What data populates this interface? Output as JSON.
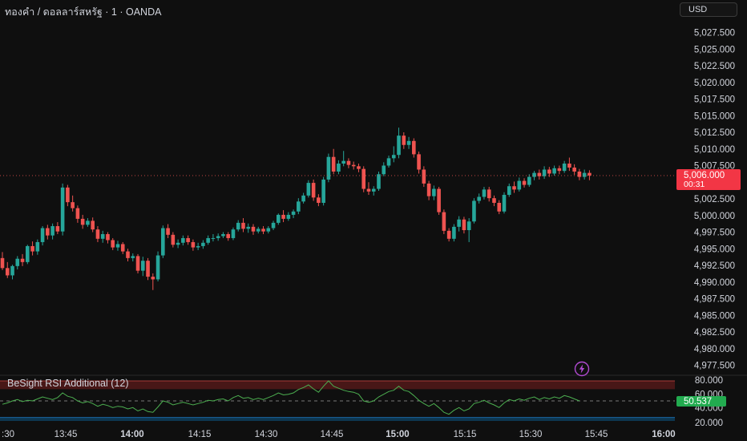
{
  "header": {
    "symbol_title": "ทองคำ / ดอลลาร์สหรัฐ · 1 · OANDA",
    "currency_button": "USD"
  },
  "price_badge": {
    "price": "5,006.000",
    "countdown": "00:31"
  },
  "indicator": {
    "name": "BeSight RSI Additional (12)",
    "current_value": "50.537",
    "axis_ticks": [
      "80.000",
      "60.000",
      "40.000",
      "20.000"
    ]
  },
  "colors": {
    "up": "#26a69a",
    "down": "#ef5350",
    "rsi_line": "#4caf50",
    "overbought_band": "#5c1b1b",
    "oversold_band": "#0d3d5c",
    "badge": "#f23645",
    "rsi_badge": "#22ab4f"
  },
  "icons": {
    "alert": "lightning-icon"
  },
  "chart_data": {
    "type": "candlestick",
    "y_axis_ticks": [
      "5,027.500",
      "5,025.000",
      "5,022.500",
      "5,020.000",
      "5,017.500",
      "5,015.000",
      "5,012.500",
      "5,010.000",
      "5,007.500",
      "5,005.000",
      "5,002.500",
      "5,000.000",
      "4,997.500",
      "4,995.000",
      "4,992.500",
      "4,990.000",
      "4,987.500",
      "4,985.000",
      "4,982.500",
      "4,980.000",
      "4,977.500"
    ],
    "x_axis_ticks": [
      {
        "label": ":30",
        "bold": false
      },
      {
        "label": "13:45",
        "bold": false
      },
      {
        "label": "14:00",
        "bold": true
      },
      {
        "label": "14:15",
        "bold": false
      },
      {
        "label": "14:30",
        "bold": false
      },
      {
        "label": "14:45",
        "bold": false
      },
      {
        "label": "15:00",
        "bold": true
      },
      {
        "label": "15:15",
        "bold": false
      },
      {
        "label": "15:30",
        "bold": false
      },
      {
        "label": "15:45",
        "bold": false
      },
      {
        "label": "16:00",
        "bold": true
      }
    ],
    "ylim": [
      4976,
      5031
    ],
    "last_price": 5006.0,
    "candles": [
      [
        4993.6,
        4994.5,
        4991.8,
        4992.1
      ],
      [
        4992.1,
        4993.0,
        4990.6,
        4991.0
      ],
      [
        4991.0,
        4992.6,
        4990.4,
        4992.4
      ],
      [
        4992.4,
        4993.9,
        4991.9,
        4993.5
      ],
      [
        4993.5,
        4994.2,
        4992.4,
        4993.0
      ],
      [
        4993.0,
        4995.6,
        4992.7,
        4995.4
      ],
      [
        4995.4,
        4996.1,
        4994.0,
        4994.6
      ],
      [
        4994.6,
        4996.4,
        4994.1,
        4996.0
      ],
      [
        4996.0,
        4998.4,
        4995.5,
        4998.1
      ],
      [
        4998.1,
        4998.6,
        4996.4,
        4997.0
      ],
      [
        4997.0,
        4998.8,
        4996.4,
        4998.4
      ],
      [
        4998.4,
        4999.0,
        4997.2,
        4997.6
      ],
      [
        4997.6,
        5004.8,
        4997.0,
        5004.2
      ],
      [
        5004.2,
        5004.6,
        5001.4,
        5002.0
      ],
      [
        5002.0,
        5003.0,
        5000.6,
        5001.1
      ],
      [
        5001.1,
        5001.5,
        4998.9,
        4999.5
      ],
      [
        4999.5,
        5000.1,
        4998.0,
        4998.6
      ],
      [
        4998.6,
        4999.6,
        4998.3,
        4999.2
      ],
      [
        4999.2,
        4999.7,
        4997.5,
        4997.9
      ],
      [
        4997.9,
        4998.4,
        4996.0,
        4996.5
      ],
      [
        4996.5,
        4997.7,
        4995.9,
        4997.2
      ],
      [
        4997.2,
        4997.5,
        4995.8,
        4996.3
      ],
      [
        4996.3,
        4996.6,
        4994.8,
        4995.2
      ],
      [
        4995.2,
        4996.2,
        4994.7,
        4995.7
      ],
      [
        4995.7,
        4996.0,
        4994.2,
        4994.6
      ],
      [
        4994.6,
        4995.0,
        4993.1,
        4993.6
      ],
      [
        4993.6,
        4994.3,
        4993.1,
        4993.9
      ],
      [
        4993.9,
        4994.2,
        4991.3,
        4991.7
      ],
      [
        4991.7,
        4993.8,
        4990.9,
        4993.2
      ],
      [
        4993.2,
        4993.6,
        4990.3,
        4990.8
      ],
      [
        4990.8,
        4991.3,
        4988.8,
        4990.4
      ],
      [
        4990.4,
        4994.6,
        4990.1,
        4994.0
      ],
      [
        4994.0,
        4998.5,
        4993.6,
        4998.1
      ],
      [
        4998.1,
        4998.7,
        4996.6,
        4997.1
      ],
      [
        4997.1,
        4997.5,
        4995.2,
        4995.6
      ],
      [
        4995.6,
        4996.4,
        4995.1,
        4995.9
      ],
      [
        4995.9,
        4997.0,
        4995.5,
        4996.6
      ],
      [
        4996.6,
        4997.0,
        4995.6,
        4996.0
      ],
      [
        4996.0,
        4996.4,
        4994.7,
        4995.2
      ],
      [
        4995.2,
        4995.9,
        4994.8,
        4995.4
      ],
      [
        4995.4,
        4996.3,
        4995.0,
        4995.9
      ],
      [
        4995.9,
        4997.0,
        4995.6,
        4996.6
      ],
      [
        4996.6,
        4997.2,
        4996.1,
        4996.6
      ],
      [
        4996.6,
        4997.3,
        4996.2,
        4996.9
      ],
      [
        4996.9,
        4997.5,
        4996.6,
        4997.2
      ],
      [
        4997.2,
        4997.5,
        4996.2,
        4996.6
      ],
      [
        4996.6,
        4998.2,
        4996.3,
        4997.9
      ],
      [
        4997.9,
        4999.3,
        4997.6,
        4998.9
      ],
      [
        4998.9,
        4999.6,
        4997.5,
        4998.0
      ],
      [
        4998.0,
        4998.8,
        4997.4,
        4998.3
      ],
      [
        4998.3,
        4998.7,
        4997.1,
        4997.6
      ],
      [
        4997.6,
        4998.3,
        4997.3,
        4998.0
      ],
      [
        4998.0,
        4998.4,
        4997.2,
        4997.6
      ],
      [
        4997.6,
        4998.4,
        4997.3,
        4998.1
      ],
      [
        4998.1,
        4999.2,
        4997.8,
        4998.9
      ],
      [
        4998.9,
        5000.3,
        4998.6,
        5000.1
      ],
      [
        5000.1,
        5000.8,
        4999.0,
        4999.5
      ],
      [
        4999.5,
        5000.5,
        4999.2,
        5000.1
      ],
      [
        5000.1,
        5000.9,
        4999.6,
        5000.6
      ],
      [
        5000.6,
        5002.6,
        5000.2,
        5002.1
      ],
      [
        5002.1,
        5003.4,
        5001.8,
        5003.0
      ],
      [
        5003.0,
        5005.3,
        5002.7,
        5004.9
      ],
      [
        5004.9,
        5005.4,
        5002.2,
        5002.7
      ],
      [
        5002.7,
        5003.2,
        5001.4,
        5001.9
      ],
      [
        5001.9,
        5005.8,
        5001.5,
        5005.4
      ],
      [
        5005.4,
        5009.3,
        5005.0,
        5008.8
      ],
      [
        5008.8,
        5010.0,
        5006.2,
        5006.6
      ],
      [
        5006.6,
        5008.3,
        5006.2,
        5007.8
      ],
      [
        5007.8,
        5009.7,
        5007.4,
        5008.2
      ],
      [
        5008.2,
        5008.6,
        5007.1,
        5007.6
      ],
      [
        5007.6,
        5008.1,
        5006.9,
        5007.4
      ],
      [
        5007.4,
        5007.8,
        5006.5,
        5007.0
      ],
      [
        5007.0,
        5007.4,
        5003.5,
        5004.0
      ],
      [
        5004.0,
        5005.0,
        5003.1,
        5003.6
      ],
      [
        5003.6,
        5004.4,
        5003.0,
        5004.0
      ],
      [
        5004.0,
        5006.6,
        5003.7,
        5006.2
      ],
      [
        5006.2,
        5008.0,
        5005.9,
        5007.5
      ],
      [
        5007.5,
        5009.0,
        5007.2,
        5008.6
      ],
      [
        5008.6,
        5010.4,
        5008.0,
        5009.1
      ],
      [
        5009.1,
        5013.2,
        5008.6,
        5012.0
      ],
      [
        5012.0,
        5012.5,
        5010.0,
        5010.6
      ],
      [
        5010.6,
        5011.8,
        5010.0,
        5011.2
      ],
      [
        5011.2,
        5011.6,
        5008.7,
        5009.2
      ],
      [
        5009.2,
        5009.6,
        5006.3,
        5006.9
      ],
      [
        5006.9,
        5007.4,
        5004.3,
        5004.8
      ],
      [
        5004.8,
        5005.2,
        5002.3,
        5002.9
      ],
      [
        5002.9,
        5004.5,
        5002.3,
        5004.0
      ],
      [
        5004.0,
        5004.3,
        5000.1,
        5000.5
      ],
      [
        5000.5,
        5000.9,
        4997.2,
        4997.7
      ],
      [
        4997.7,
        4998.1,
        4996.1,
        4996.5
      ],
      [
        4996.5,
        4998.7,
        4996.1,
        4998.3
      ],
      [
        4998.3,
        4999.9,
        4997.6,
        4999.4
      ],
      [
        4999.4,
        4999.8,
        4997.3,
        4997.8
      ],
      [
        4997.8,
        4999.6,
        4996.0,
        4999.1
      ],
      [
        4999.1,
        5002.6,
        4998.8,
        5002.2
      ],
      [
        5002.2,
        5003.3,
        5001.8,
        5002.8
      ],
      [
        5002.8,
        5004.3,
        5002.4,
        5003.9
      ],
      [
        5003.9,
        5004.3,
        5002.1,
        5002.6
      ],
      [
        5002.6,
        5003.0,
        5001.4,
        5001.9
      ],
      [
        5001.9,
        5002.3,
        5000.2,
        5000.6
      ],
      [
        5000.6,
        5003.5,
        5000.3,
        5003.1
      ],
      [
        5003.1,
        5004.8,
        5002.8,
        5004.4
      ],
      [
        5004.4,
        5005.1,
        5003.4,
        5003.9
      ],
      [
        5003.9,
        5005.7,
        5003.6,
        5005.2
      ],
      [
        5005.2,
        5005.6,
        5004.2,
        5004.6
      ],
      [
        5004.6,
        5006.2,
        5004.3,
        5005.8
      ],
      [
        5005.8,
        5006.7,
        5005.3,
        5006.4
      ],
      [
        5006.4,
        5006.9,
        5005.4,
        5005.9
      ],
      [
        5005.9,
        5007.4,
        5005.5,
        5006.9
      ],
      [
        5006.9,
        5007.3,
        5005.8,
        5006.3
      ],
      [
        5006.3,
        5007.5,
        5006.0,
        5007.1
      ],
      [
        5007.1,
        5007.5,
        5006.2,
        5006.7
      ],
      [
        5006.7,
        5008.2,
        5006.4,
        5007.8
      ],
      [
        5007.8,
        5008.7,
        5006.7,
        5007.2
      ],
      [
        5007.2,
        5007.7,
        5006.1,
        5006.6
      ],
      [
        5006.6,
        5007.0,
        5005.3,
        5005.8
      ],
      [
        5005.8,
        5006.9,
        5005.4,
        5006.4
      ],
      [
        5006.4,
        5006.8,
        5005.3,
        5006.0
      ]
    ],
    "rsi": [
      45,
      47,
      50,
      52,
      49,
      51,
      50,
      53,
      56,
      54,
      52,
      55,
      62,
      57,
      55,
      50,
      47,
      49,
      46,
      42,
      45,
      43,
      40,
      42,
      41,
      38,
      40,
      35,
      38,
      34,
      33,
      41,
      50,
      48,
      44,
      46,
      48,
      46,
      44,
      46,
      48,
      51,
      50,
      52,
      53,
      50,
      55,
      58,
      54,
      55,
      52,
      54,
      52,
      55,
      58,
      62,
      59,
      60,
      62,
      67,
      70,
      74,
      68,
      63,
      72,
      80,
      72,
      69,
      66,
      64,
      63,
      60,
      50,
      48,
      50,
      56,
      60,
      64,
      66,
      72,
      66,
      64,
      58,
      51,
      46,
      42,
      46,
      40,
      33,
      30,
      36,
      40,
      35,
      38,
      46,
      48,
      51,
      47,
      44,
      40,
      47,
      52,
      50,
      53,
      51,
      54,
      56,
      52,
      55,
      53,
      56,
      54,
      58,
      56,
      53,
      50
    ],
    "rsi_levels": {
      "overbought": 80,
      "upper": 70,
      "middle": 50,
      "lower": 30,
      "oversold": 20
    }
  }
}
